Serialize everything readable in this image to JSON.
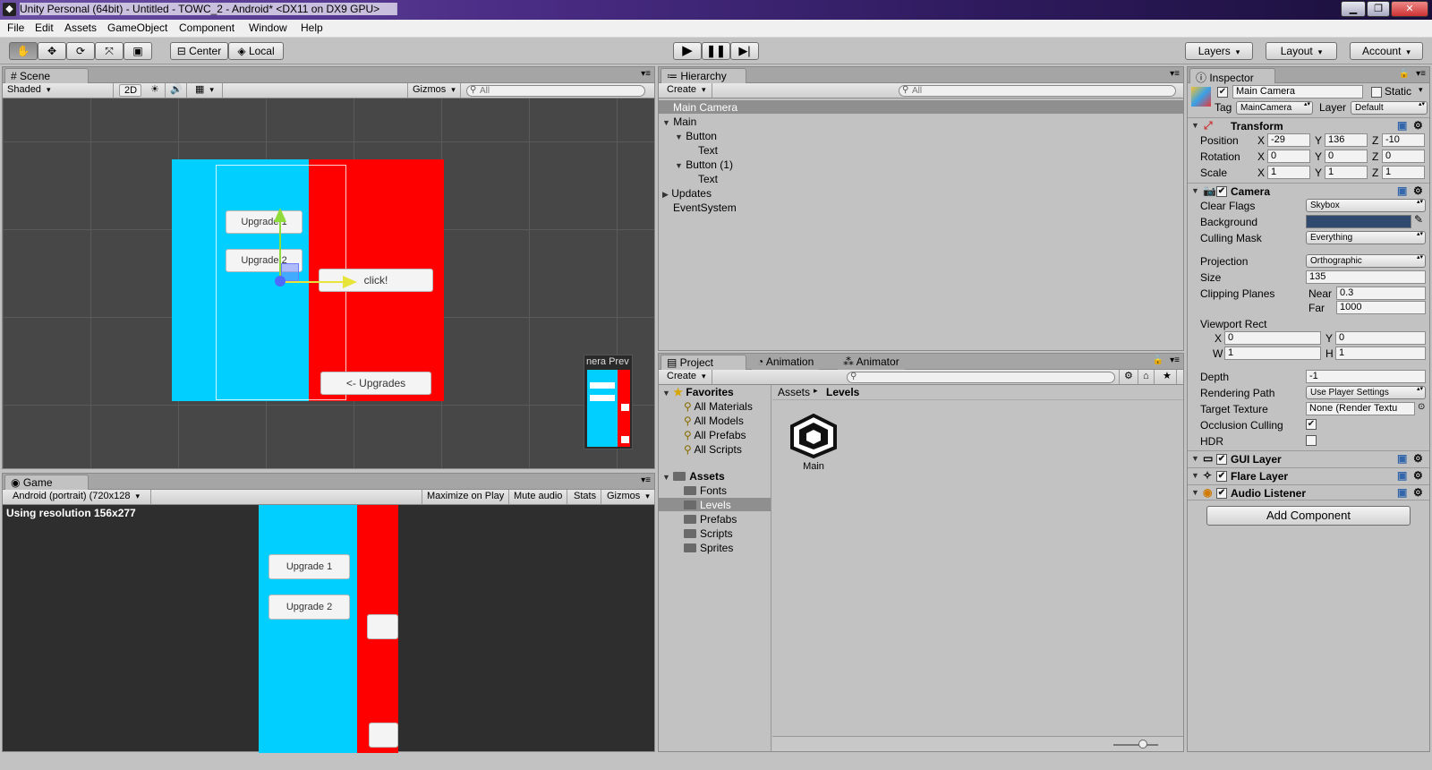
{
  "window": {
    "title": "Unity Personal (64bit) - Untitled - TOWC_2 - Android* <DX11 on DX9 GPU>",
    "minimize": "▁",
    "maximize": "❐",
    "close": "✕"
  },
  "menu": [
    "File",
    "Edit",
    "Assets",
    "GameObject",
    "Component",
    "Window",
    "Help"
  ],
  "toolbar": {
    "center": "Center",
    "local": "Local",
    "layers": "Layers",
    "layout": "Layout",
    "account": "Account",
    "play_icon": "play-icon",
    "pause_icon": "pause-icon",
    "step_icon": "step-icon"
  },
  "scene": {
    "tab": "Scene",
    "shaded": "Shaded",
    "mode2d": "2D",
    "gizmos": "Gizmos",
    "search": "All",
    "btn_upgrade1": "Upgrade 1",
    "btn_upgrade2": "Upgrade 2",
    "btn_click": "click!",
    "btn_upgrades": "<- Upgrades",
    "camera_preview": "nera Prev",
    "colors": {
      "blue": "#00cfff",
      "red": "#ff0000"
    }
  },
  "game": {
    "tab": "Game",
    "resolution_dropdown": "Android (portrait) (720x128",
    "resolution_text": "Using resolution 156x277",
    "maximize": "Maximize on Play",
    "mute": "Mute audio",
    "stats": "Stats",
    "gizmos": "Gizmos",
    "btn_upgrade1": "Upgrade 1",
    "btn_upgrade2": "Upgrade 2"
  },
  "hierarchy": {
    "tab": "Hierarchy",
    "create": "Create",
    "search": "All",
    "items": [
      "Main Camera",
      "Main",
      "Button",
      "Text",
      "Button (1)",
      "Text",
      "Updates",
      "EventSystem"
    ]
  },
  "project": {
    "tabs": [
      "Project",
      "Animation",
      "Animator"
    ],
    "create": "Create",
    "favorites_label": "Favorites",
    "favorites": [
      "All Materials",
      "All Models",
      "All Prefabs",
      "All Scripts"
    ],
    "assets_label": "Assets",
    "folders": [
      "Fonts",
      "Levels",
      "Prefabs",
      "Scripts",
      "Sprites"
    ],
    "breadcrumb": [
      "Assets",
      "Levels"
    ],
    "asset_name": "Main"
  },
  "inspector": {
    "tab": "Inspector",
    "object_name": "Main Camera",
    "static": "Static",
    "tag_label": "Tag",
    "tag": "MainCamera",
    "layer_label": "Layer",
    "layer": "Default",
    "transform": {
      "title": "Transform",
      "position": "Position",
      "rotation": "Rotation",
      "scale": "Scale",
      "pos": [
        "-29",
        "136",
        "-10"
      ],
      "rot": [
        "0",
        "0",
        "0"
      ],
      "scl": [
        "1",
        "1",
        "1"
      ]
    },
    "camera": {
      "title": "Camera",
      "clear_flags": "Clear Flags",
      "clear_flags_val": "Skybox",
      "background": "Background",
      "background_color": "#2f4a6e",
      "culling_mask": "Culling Mask",
      "culling_mask_val": "Everything",
      "projection": "Projection",
      "projection_val": "Orthographic",
      "size": "Size",
      "size_val": "135",
      "clipping": "Clipping Planes",
      "near": "Near",
      "near_val": "0.3",
      "far": "Far",
      "far_val": "1000",
      "viewport": "Viewport Rect",
      "vx": "0",
      "vy": "0",
      "vw": "1",
      "vh": "1",
      "depth": "Depth",
      "depth_val": "-1",
      "rendering_path": "Rendering Path",
      "rendering_path_val": "Use Player Settings",
      "target_texture": "Target Texture",
      "target_texture_val": "None (Render Textu",
      "occlusion": "Occlusion Culling",
      "hdr": "HDR"
    },
    "gui_layer": "GUI Layer",
    "flare_layer": "Flare Layer",
    "audio_listener": "Audio Listener",
    "add_component": "Add Component"
  }
}
